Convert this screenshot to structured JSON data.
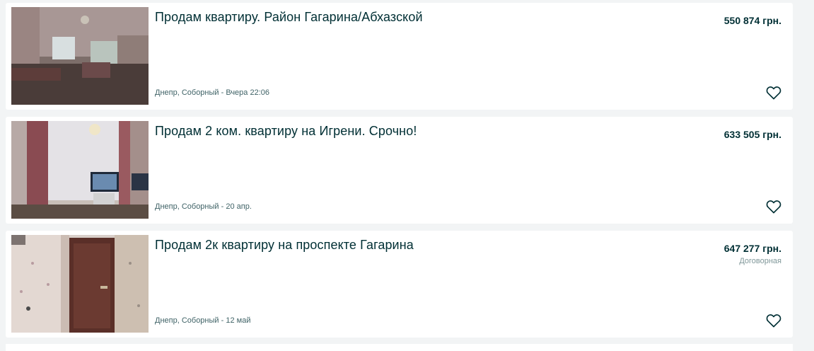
{
  "listings": [
    {
      "title": "Продам квартиру. Район Гагарина/Абхазской",
      "price": "550 874 грн.",
      "negotiable": "",
      "location": "Днепр, Соборный",
      "date": "Вчера 22:06",
      "favorite_icon": "heart-outline"
    },
    {
      "title": "Продам 2 ком. квартиру на Игрени. Срочно!",
      "price": "633 505 грн.",
      "negotiable": "",
      "location": "Днепр, Соборный",
      "date": "20 апр.",
      "favorite_icon": "heart-outline"
    },
    {
      "title": "Продам 2к квартиру на проспекте Гагарина",
      "price": "647 277 грн.",
      "negotiable": "Договорная",
      "location": "Днепр, Соборный",
      "date": "12 май",
      "favorite_icon": "heart-outline"
    }
  ],
  "meta_separator": " - ",
  "colors": {
    "page_background": "#f2f4f5",
    "card_background": "#ffffff",
    "title_text": "#002f34",
    "meta_text": "#406367",
    "negotiable_text": "#7f9799"
  }
}
